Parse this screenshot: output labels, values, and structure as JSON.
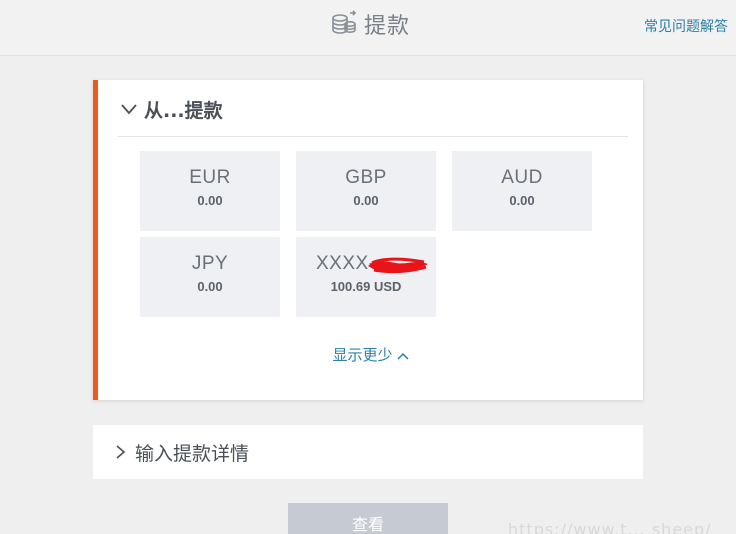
{
  "header": {
    "title": "提款",
    "faq_link": "常见问题解答",
    "title_icon": "coins-icon"
  },
  "from_section": {
    "heading": "从...提款",
    "expanded": true,
    "accent_color": "#f05a14",
    "accounts": [
      {
        "code": "EUR",
        "amount": "0.00"
      },
      {
        "code": "GBP",
        "amount": "0.00"
      },
      {
        "code": "AUD",
        "amount": "0.00"
      },
      {
        "code": "JPY",
        "amount": "0.00"
      },
      {
        "code": "XXXX-",
        "amount": "100.69 USD",
        "redacted": true
      }
    ],
    "show_less": "显示更少"
  },
  "details_section": {
    "heading": "输入提款详情",
    "expanded": false
  },
  "submit": {
    "label": "查看"
  },
  "watermark": "https://www.t... sheep/"
}
